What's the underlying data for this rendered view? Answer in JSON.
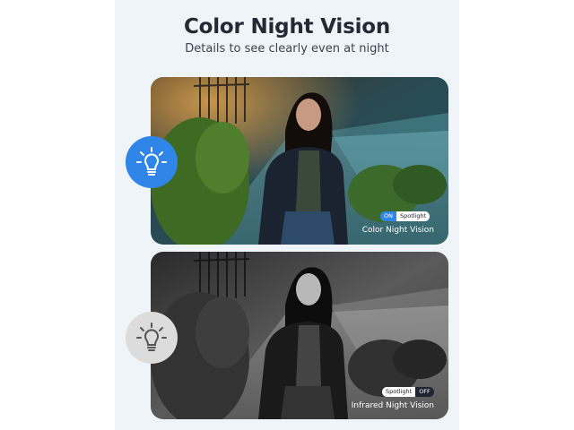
{
  "header": {
    "title": "Color Night Vision",
    "subtitle": "Details to see clearly even at night"
  },
  "color_card": {
    "toggle_state": "ON",
    "toggle_label": "Spotlight",
    "caption": "Color Night Vision"
  },
  "ir_card": {
    "toggle_label": "Spotlight",
    "toggle_state": "OFF",
    "caption": "Infrared Night Vision"
  },
  "icons": {
    "color_mode": "lightbulb-icon",
    "ir_mode": "lightbulb-icon"
  },
  "colors": {
    "accent": "#2f86e8",
    "panel_background": "#eef4f8",
    "icon_inactive": "#dcdcdc"
  }
}
